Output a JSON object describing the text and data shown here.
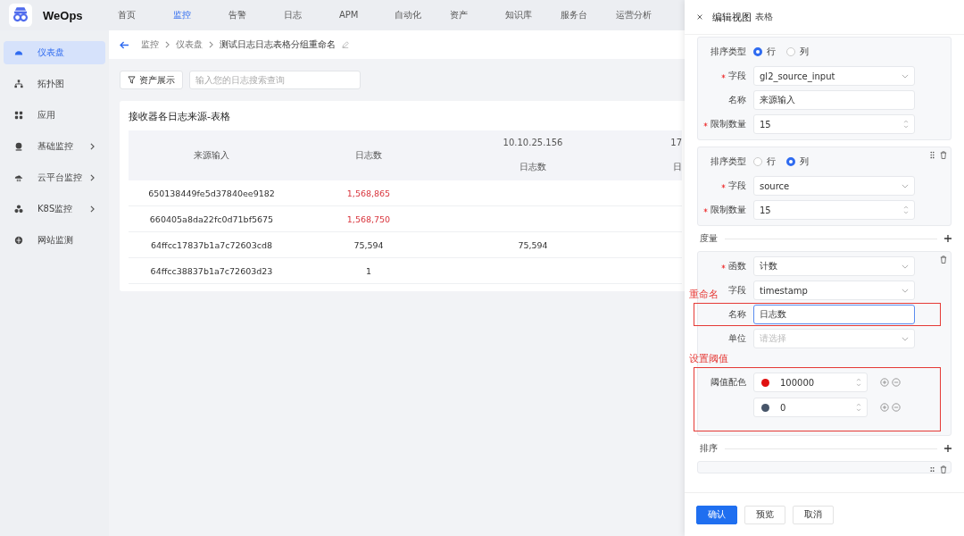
{
  "app": {
    "name": "WeOps"
  },
  "top_nav": [
    {
      "label": "首页",
      "selected": false
    },
    {
      "label": "监控",
      "selected": true
    },
    {
      "label": "告警",
      "selected": false
    },
    {
      "label": "日志",
      "selected": false
    },
    {
      "label": "APM",
      "selected": false
    },
    {
      "label": "自动化",
      "selected": false
    },
    {
      "label": "资产",
      "selected": false
    },
    {
      "label": "知识库",
      "selected": false
    },
    {
      "label": "服务台",
      "selected": false
    },
    {
      "label": "运营分析",
      "selected": false
    }
  ],
  "sidebar": {
    "items": [
      {
        "label": "仪表盘",
        "selected": true,
        "has_submenu": false
      },
      {
        "label": "拓扑图",
        "selected": false,
        "has_submenu": false
      },
      {
        "label": "应用",
        "selected": false,
        "has_submenu": false
      },
      {
        "label": "基础监控",
        "selected": false,
        "has_submenu": true
      },
      {
        "label": "云平台监控",
        "selected": false,
        "has_submenu": true
      },
      {
        "label": "K8S监控",
        "selected": false,
        "has_submenu": true
      },
      {
        "label": "网站监测",
        "selected": false,
        "has_submenu": false
      }
    ]
  },
  "breadcrumb": [
    "监控",
    "仪表盘",
    "测试日志日志表格分组重命名"
  ],
  "toolbar": {
    "filter_button": "资产展示",
    "search": {
      "placeholder": "输入您的日志搜索查询"
    }
  },
  "panel": {
    "title": "接收器各日志来源-表格",
    "table": {
      "columns": [
        {
          "label": "来源输入"
        },
        {
          "label": "日志数"
        },
        {
          "label": "10.10.25.156",
          "sub_label": "日志数"
        },
        {
          "label": "17",
          "sub_label": "日"
        }
      ],
      "rows": [
        {
          "cells": [
            {
              "text": "650138449fe5d37840ee9182",
              "alert": false
            },
            {
              "text": "1,568,865",
              "alert": true
            }
          ]
        },
        {
          "cells": [
            {
              "text": "660405a8da22fc0d71bf5675",
              "alert": false
            },
            {
              "text": "1,568,750",
              "alert": true
            }
          ]
        },
        {
          "cells": [
            {
              "text": "64ffcc17837b1a7c72603cd8",
              "alert": false
            },
            {
              "text": "75,594",
              "alert": false
            },
            {
              "text": "75,594",
              "alert": false
            }
          ]
        },
        {
          "cells": [
            {
              "text": "64ffcc38837b1a7c72603d23",
              "alert": false
            },
            {
              "text": "1",
              "alert": false
            }
          ]
        }
      ]
    }
  },
  "drawer": {
    "title": "编辑视图",
    "subtitle": "表格",
    "group_cards": [
      {
        "has_actions": false,
        "sort_type": {
          "label": "排序类型",
          "options": [
            {
              "label": "行",
              "selected": true
            },
            {
              "label": "列",
              "selected": false
            }
          ]
        },
        "fields": [
          {
            "label": "字段",
            "required": true,
            "kind": "select",
            "value": "gl2_source_input"
          },
          {
            "label": "名称",
            "required": false,
            "kind": "input",
            "value": "来源输入"
          },
          {
            "label": "限制数量",
            "required": true,
            "kind": "number",
            "value": "15"
          }
        ]
      },
      {
        "has_actions": true,
        "sort_type": {
          "label": "排序类型",
          "options": [
            {
              "label": "行",
              "selected": false
            },
            {
              "label": "列",
              "selected": true
            }
          ]
        },
        "fields": [
          {
            "label": "字段",
            "required": true,
            "kind": "select",
            "value": "source"
          },
          {
            "label": "限制数量",
            "required": true,
            "kind": "number",
            "value": "15"
          }
        ]
      }
    ],
    "metric_section": {
      "title": "度量",
      "fields": [
        {
          "label": "函数",
          "required": true,
          "kind": "select",
          "value": "计数",
          "focused": false
        },
        {
          "label": "字段",
          "required": false,
          "kind": "select",
          "value": "timestamp",
          "focused": false
        },
        {
          "label": "名称",
          "required": false,
          "kind": "input",
          "value": "日志数",
          "focused": true,
          "annotation": "重命名"
        },
        {
          "label": "单位",
          "required": false,
          "kind": "select",
          "placeholder": "请选择",
          "focused": false
        }
      ],
      "thresholds": {
        "label": "阈值配色",
        "annotation": "设置阈值",
        "items": [
          {
            "color": "#e01010",
            "value": "100000"
          },
          {
            "color": "#475569",
            "value": "0"
          }
        ]
      }
    },
    "sort_section": {
      "title": "排序"
    },
    "buttons": [
      {
        "label": "确认",
        "primary": true
      },
      {
        "label": "预览",
        "primary": false
      },
      {
        "label": "取消",
        "primary": false
      }
    ]
  }
}
